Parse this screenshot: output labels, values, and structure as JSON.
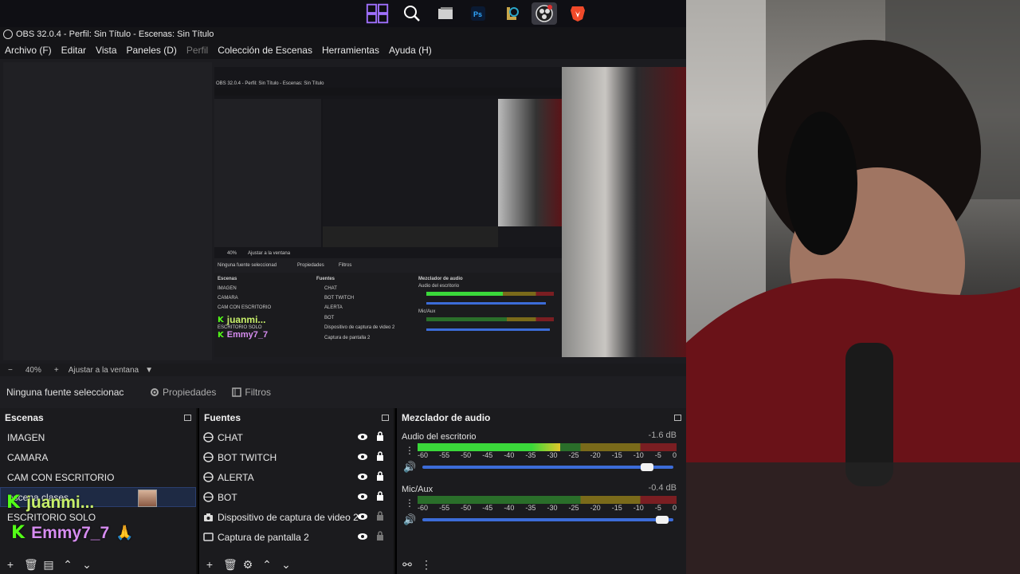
{
  "window_title": "OBS 32.0.4 - Perfil: Sin Título - Escenas: Sin Título",
  "menu": [
    "Archivo (F)",
    "Editar",
    "Vista",
    "Paneles (D)",
    "Perfil",
    "Colección de Escenas",
    "Herramientas",
    "Ayuda (H)"
  ],
  "taskbar_icons": [
    "windows-icon",
    "search-icon",
    "task-view-icon",
    "photoshop-icon",
    "league-icon",
    "obs-icon",
    "brave-icon"
  ],
  "zoom": {
    "minus": "−",
    "level": "40%",
    "plus": "+",
    "fit": "Ajustar a la ventana"
  },
  "source_bar": {
    "none_selected": "Ninguna fuente seleccionac",
    "properties": "Propiedades",
    "filters": "Filtros"
  },
  "scenes": {
    "title": "Escenas",
    "items": [
      "IMAGEN",
      "CAMARA",
      "CAM CON ESCRITORIO",
      "escena clases",
      "ESCRITORIO SOLO"
    ],
    "selected_index": 3
  },
  "sources": {
    "title": "Fuentes",
    "items": [
      "CHAT",
      "BOT TWITCH",
      "ALERTA",
      "BOT",
      "Dispositivo de captura de video 2",
      "Captura de pantalla 2"
    ]
  },
  "mixer": {
    "title": "Mezclador de audio",
    "channels": [
      {
        "name": "Audio del escritorio",
        "db": "-1.6 dB",
        "level": 0.55,
        "volume": 0.92
      },
      {
        "name": "Mic/Aux",
        "db": "-0.4 dB",
        "level": 0.0,
        "volume": 0.98
      }
    ],
    "ticks": [
      "-60",
      "-55",
      "-50",
      "-45",
      "-40",
      "-35",
      "-30",
      "-25",
      "-20",
      "-15",
      "-10",
      "-5",
      "0"
    ]
  },
  "overlays": {
    "user1": "juanmi...",
    "user2": "Emmy7_7"
  },
  "nested": {
    "scenes": [
      "IMAGEN",
      "CAMARA",
      "CAM CON ESCRITORIO",
      "ESCRITORIO SOLO"
    ],
    "sources": [
      "CHAT",
      "BOT TWITCH",
      "ALERTA",
      "BOT",
      "Dispositivo de captura de video 2",
      "Captura de pantalla 2"
    ],
    "none": "Ninguna fuente seleccionad",
    "props": "Propiedades",
    "filters": "Filtros",
    "mixer_title": "Mezclador de audio",
    "ch1": "Audio del escritorio",
    "ch2": "Mic/Aux",
    "zoom": "40%",
    "fit": "Ajustar a la ventana",
    "scenes_title": "Escenas",
    "sources_title": "Fuentes"
  }
}
